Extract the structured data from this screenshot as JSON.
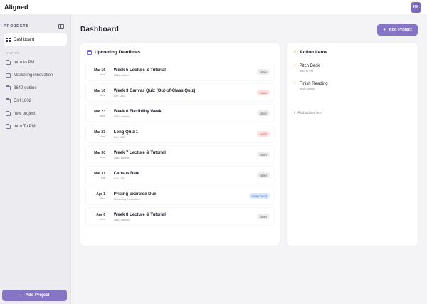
{
  "app": {
    "logo": "Aligned",
    "avatar_initials": "KK"
  },
  "sidebar": {
    "title": "PROJECTS",
    "dashboard_label": "Dashboard",
    "section_label": "ACTIVE",
    "projects": [
      "Intro to PM",
      "Marketing innovation",
      "3640 outline",
      "Civl 1802",
      "new project",
      "Intro To PM"
    ],
    "add_project_label": "Add Project"
  },
  "main": {
    "title": "Dashboard",
    "add_project_label": "Add Project",
    "deadlines": {
      "heading": "Upcoming Deadlines",
      "items": [
        {
          "date": "Mar 16",
          "weekday": "Mon",
          "title": "Week 5 Lecture & Tutorial",
          "project": "3640 outline",
          "tag": "other"
        },
        {
          "date": "Mar 16",
          "weekday": "Mon",
          "title": "Week 3 Canvas Quiz (Out-of-Class Quiz)",
          "project": "Civl 1802",
          "tag": "exam"
        },
        {
          "date": "Mar 23",
          "weekday": "Mon",
          "title": "Week 6 Flexibility Week",
          "project": "3640 outline",
          "tag": "other"
        },
        {
          "date": "Mar 23",
          "weekday": "Mon",
          "title": "Long Quiz 1",
          "project": "Civl 1802",
          "tag": "exam"
        },
        {
          "date": "Mar 30",
          "weekday": "Mon",
          "title": "Week 7 Lecture & Tutorial",
          "project": "3640 outline",
          "tag": "other"
        },
        {
          "date": "Mar 31",
          "weekday": "Tue",
          "title": "Census Date",
          "project": "Civl 1802",
          "tag": "other"
        },
        {
          "date": "Apr 1",
          "weekday": "Wed",
          "title": "Pricing Exercise Due",
          "project": "Marketing innovation",
          "tag": "assignment"
        },
        {
          "date": "Apr 6",
          "weekday": "Mon",
          "title": "Week 8 Lecture & Tutorial",
          "project": "3640 outline",
          "tag": "other"
        }
      ]
    },
    "actions": {
      "heading": "Action Items",
      "items": [
        {
          "title": "Pitch Deck",
          "project": "Intro to PM"
        },
        {
          "title": "Finish Reading",
          "project": "3640 outline"
        }
      ],
      "add_label": "Add action item"
    }
  }
}
